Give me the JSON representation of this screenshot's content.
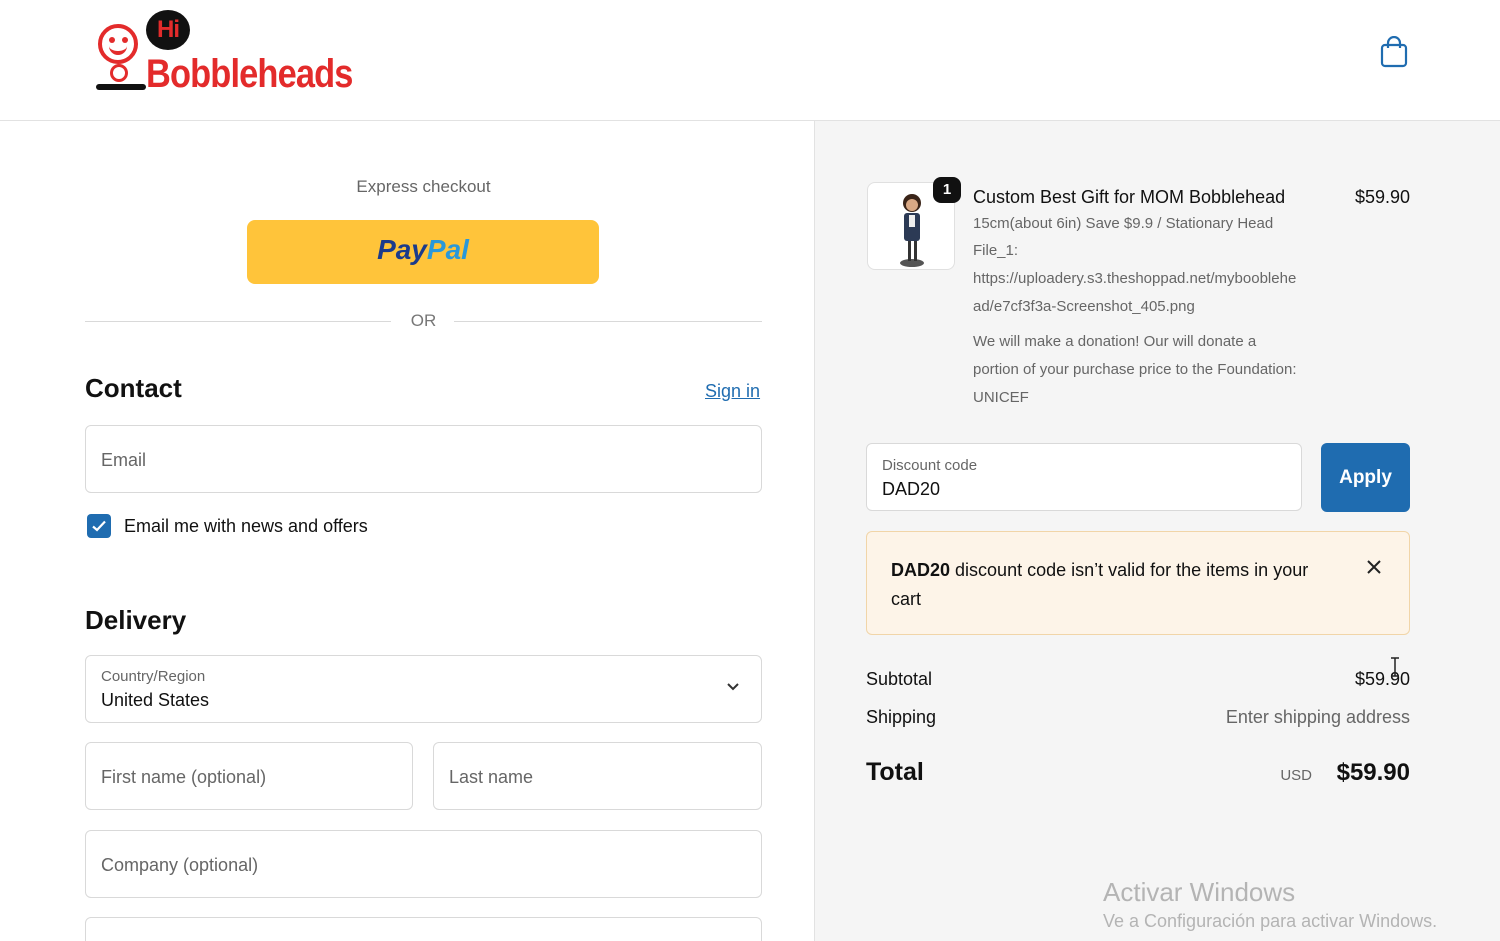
{
  "header": {
    "logo_bubble": "Hi",
    "logo_text": "Bobbleheads",
    "cart_icon": "shopping-bag-icon"
  },
  "express": {
    "label": "Express checkout",
    "paypal_part1": "Pay",
    "paypal_part2": "Pal",
    "or_label": "OR"
  },
  "contact": {
    "title": "Contact",
    "sign_in": "Sign in",
    "email_placeholder": "Email",
    "newsletter_label": "Email me with news and offers",
    "newsletter_checked": true
  },
  "delivery": {
    "title": "Delivery",
    "country_label": "Country/Region",
    "country_value": "United States",
    "first_name_placeholder": "First name (optional)",
    "last_name_placeholder": "Last name",
    "company_placeholder": "Company (optional)"
  },
  "order": {
    "item": {
      "quantity": "1",
      "name": "Custom Best Gift for MOM Bobblehead",
      "price": "$59.90",
      "variant": "15cm(about 6in) Save $9.9 / Stationary Head",
      "file_label": "File_1:",
      "file_url_line1": "https://uploadery.s3.theshoppad.net/mybooblehe",
      "file_url_line2": "ad/e7cf3f3a-Screenshot_405.png",
      "donation_line1": "We will make a donation! Our will donate a",
      "donation_line2": "portion of your purchase price to the Foundation:",
      "donation_line3": "UNICEF"
    },
    "discount": {
      "label": "Discount code",
      "value": "DAD20",
      "apply": "Apply"
    },
    "error": {
      "code": "DAD20",
      "message": " discount code isn’t valid for the items in your cart"
    },
    "subtotal_label": "Subtotal",
    "subtotal_value": "$59.90",
    "shipping_label": "Shipping",
    "shipping_value": "Enter shipping address",
    "total_label": "Total",
    "total_currency": "USD",
    "total_value": "$59.90"
  },
  "watermark": {
    "title": "Activar Windows",
    "subtitle": "Ve a Configuración para activar Windows."
  },
  "colors": {
    "brand_red": "#e32b2b",
    "accent_blue": "#1f6cb0",
    "paypal_yellow": "#ffc43a",
    "error_bg": "#fdf4e8"
  }
}
